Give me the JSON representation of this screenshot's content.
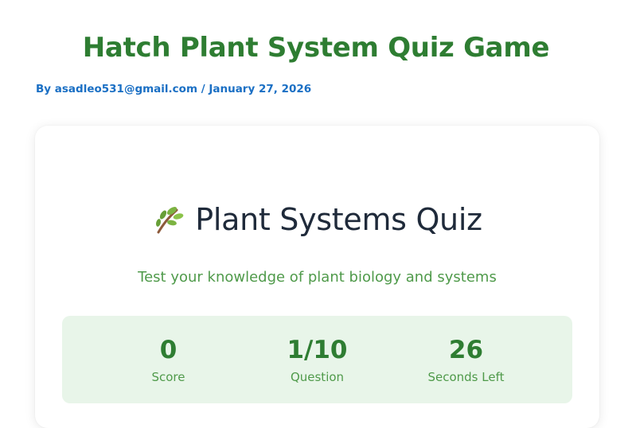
{
  "page": {
    "title": "Hatch Plant System Quiz Game",
    "byline": "By asadleo531@gmail.com / January 27, 2026"
  },
  "quiz": {
    "icon": "herb-leaf-icon",
    "title": "Plant Systems Quiz",
    "subtitle": "Test your knowledge of plant biology and systems",
    "stats": [
      {
        "value": "0",
        "label": "Score"
      },
      {
        "value": "1/10",
        "label": "Question"
      },
      {
        "value": "26",
        "label": "Seconds Left"
      }
    ]
  },
  "colors": {
    "accent_green": "#2e7d32",
    "light_green": "#4f9a4a",
    "stats_bg": "#e8f5e9",
    "byline_blue": "#1a6fc4",
    "title_dark": "#1f2a3a"
  }
}
